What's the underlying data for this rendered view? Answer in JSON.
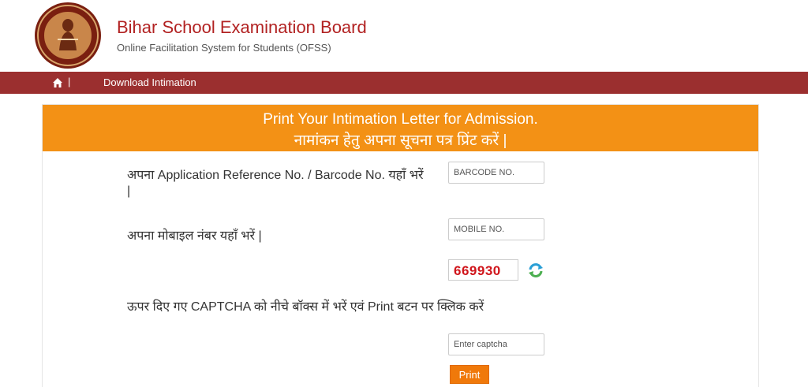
{
  "header": {
    "title": "Bihar School Examination Board",
    "subtitle": "Online Facilitation System for Students (OFSS)",
    "logo_icon": "bseb-emblem-logo"
  },
  "nav": {
    "home_icon": "home-icon",
    "separator": "|",
    "link_label": "Download Intimation",
    "bg_color": "#9b2f2f"
  },
  "panel": {
    "heading_en": "Print Your Intimation Letter for Admission.",
    "heading_hi": "नामांकन हेतु अपना सूचना पत्र प्रिंट करें |",
    "heading_color": "#f39115"
  },
  "form": {
    "barcode_label": "अपना Application Reference No. / Barcode No. यहाँ भरें |",
    "barcode_placeholder": "BARCODE NO.",
    "mobile_label": "अपना मोबाइल नंबर यहाँ भरें |",
    "mobile_placeholder": "MOBILE NO.",
    "captcha_value": "669930",
    "captcha_instruction": "ऊपर दिए गए CAPTCHA को नीचे बॉक्स में भरें एवं Print बटन पर क्लिक करें",
    "captcha_placeholder": "Enter captcha",
    "refresh_icon": "refresh-icon",
    "print_label": "Print",
    "print_color": "#f0790a"
  }
}
